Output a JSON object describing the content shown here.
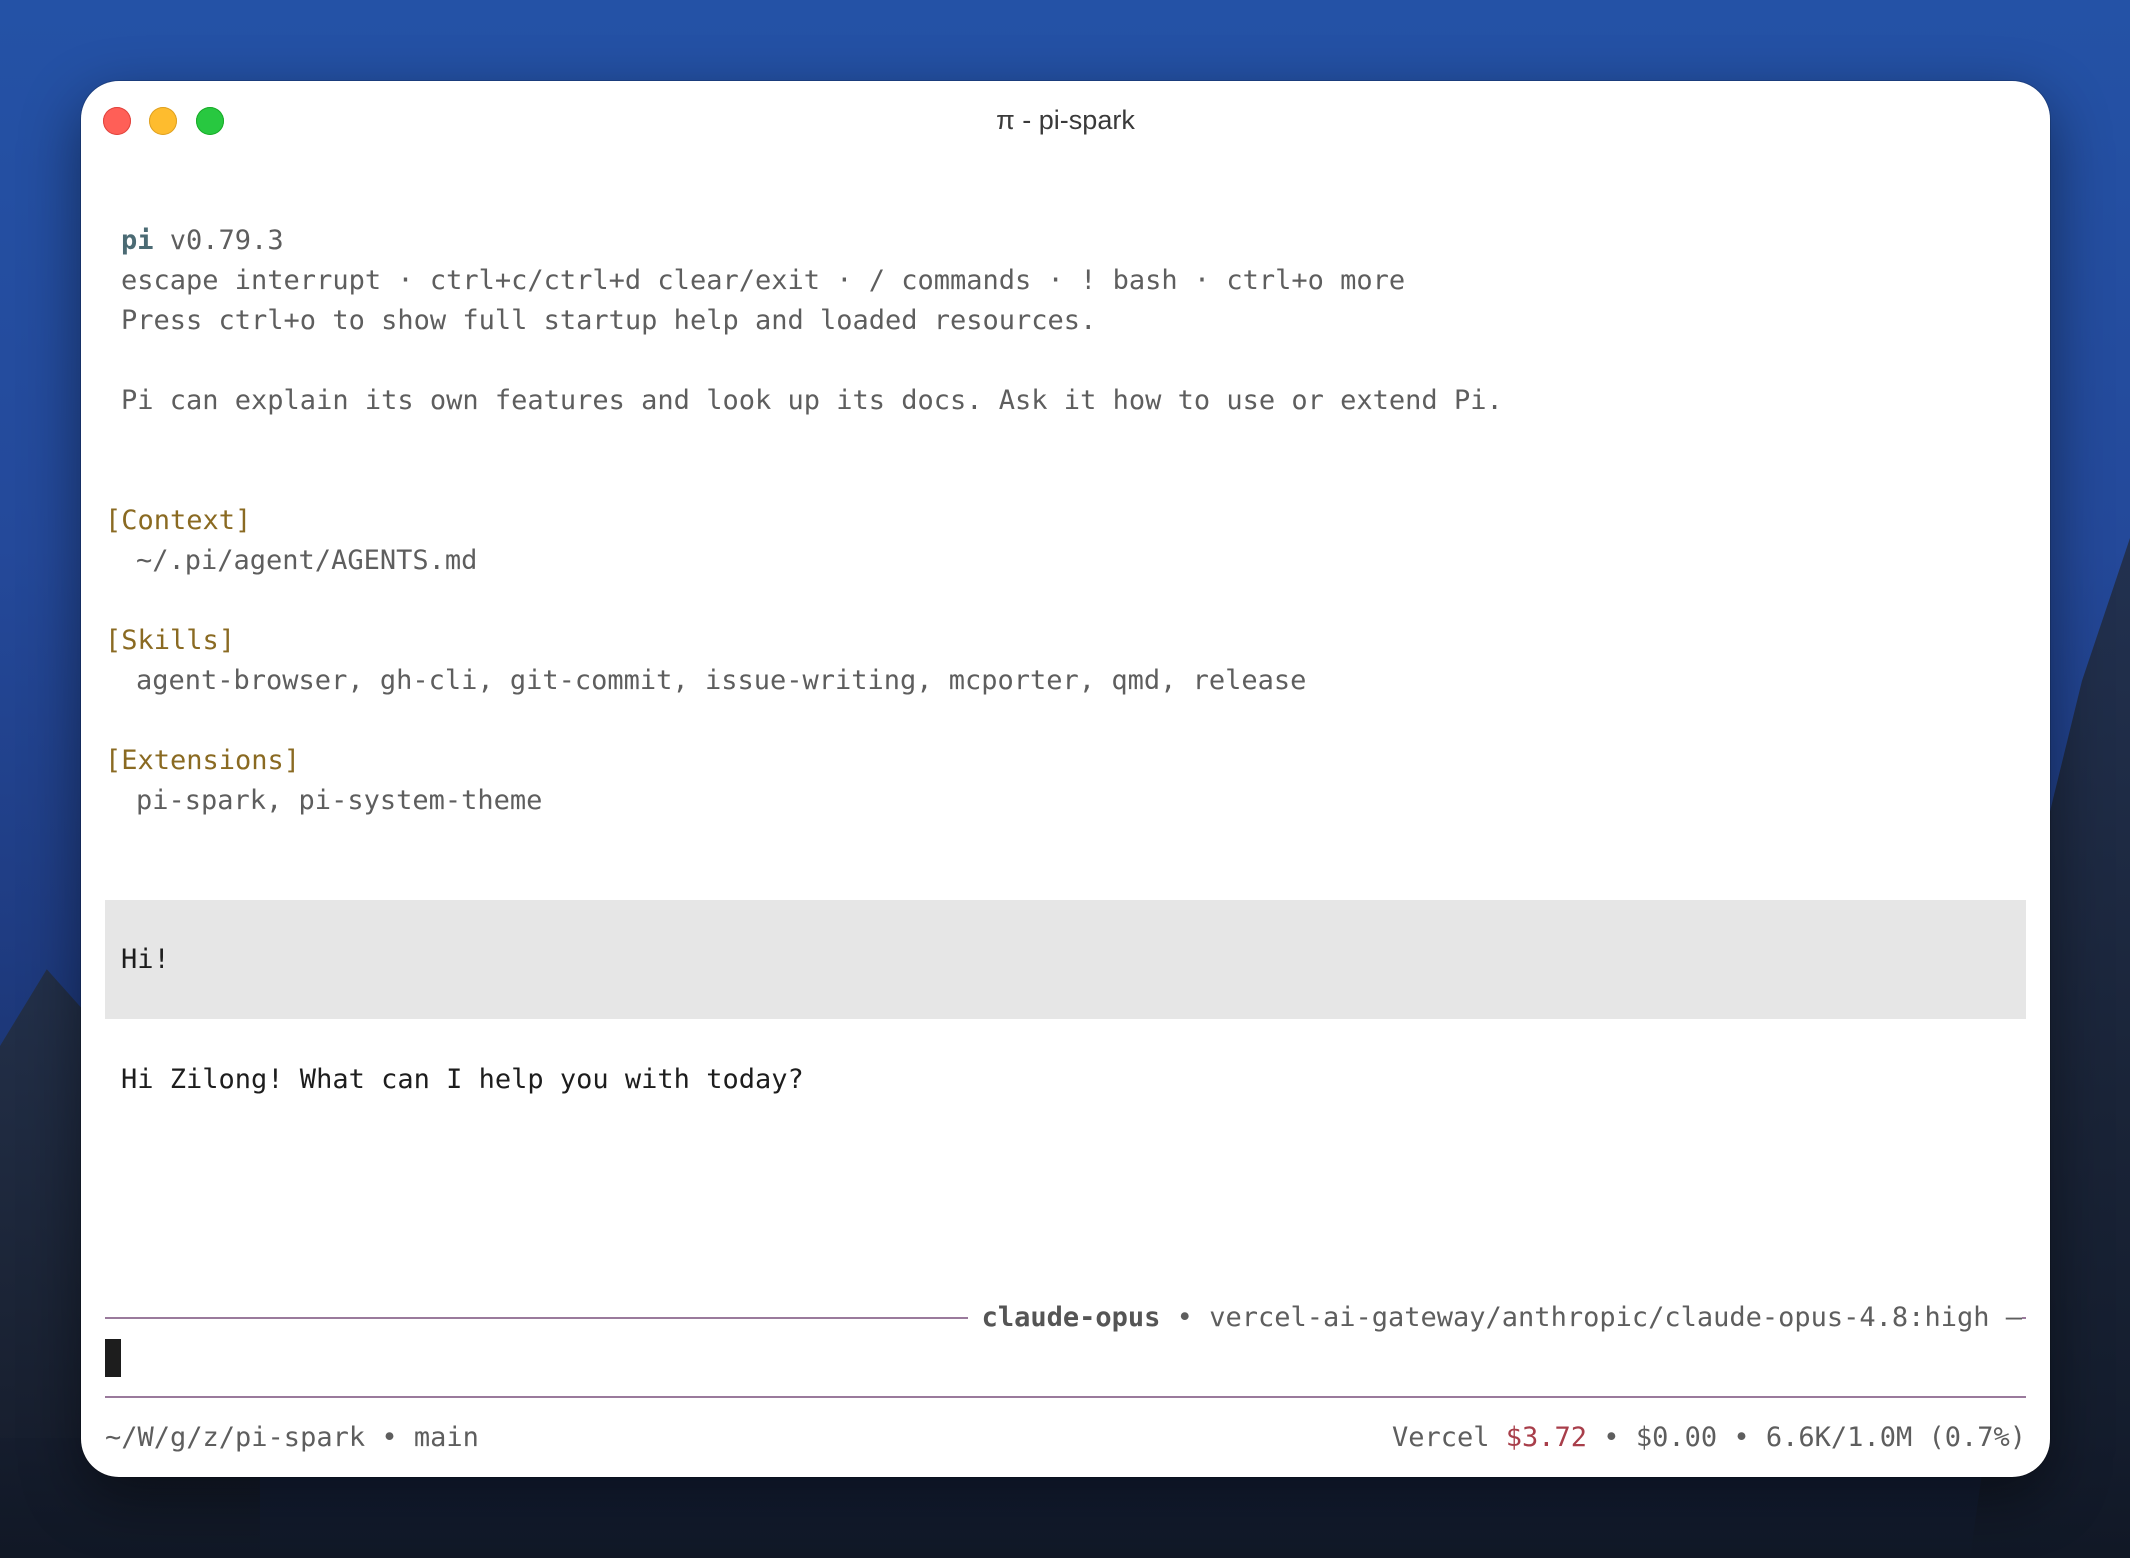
{
  "window": {
    "title": "π - pi-spark"
  },
  "header": {
    "app_name": "pi",
    "version": "v0.79.3",
    "shortcuts": "escape interrupt · ctrl+c/ctrl+d clear/exit · / commands · ! bash · ctrl+o more",
    "help_hint": "Press ctrl+o to show full startup help and loaded resources.",
    "intro": "Pi can explain its own features and look up its docs. Ask it how to use or extend Pi."
  },
  "sections": {
    "context": {
      "title": "[Context]",
      "value": "~/.pi/agent/AGENTS.md"
    },
    "skills": {
      "title": "[Skills]",
      "value": "agent-browser, gh-cli, git-commit, issue-writing, mcporter, qmd, release"
    },
    "extensions": {
      "title": "[Extensions]",
      "value": "pi-spark, pi-system-theme"
    }
  },
  "conversation": {
    "user_message": "Hi!",
    "assistant_message": "Hi Zilong! What can I help you with today?"
  },
  "input": {
    "model_name": "claude-opus",
    "separator": "•",
    "model_path": "vercel-ai-gateway/anthropic/claude-opus-4.8:high",
    "trailing_dash": "—"
  },
  "status": {
    "path": "~/W/g/z/pi-spark",
    "separator": "•",
    "branch": "main",
    "provider": "Vercel",
    "provider_cost": "$3.72",
    "session_cost": "$0.00",
    "tokens": "6.6K/1.0M (0.7%)"
  },
  "colors": {
    "section_title": "#8a6a22",
    "accent_rule": "#9a7a9c",
    "cost_red": "#a83e4a",
    "pi_name": "#4b6b74"
  }
}
